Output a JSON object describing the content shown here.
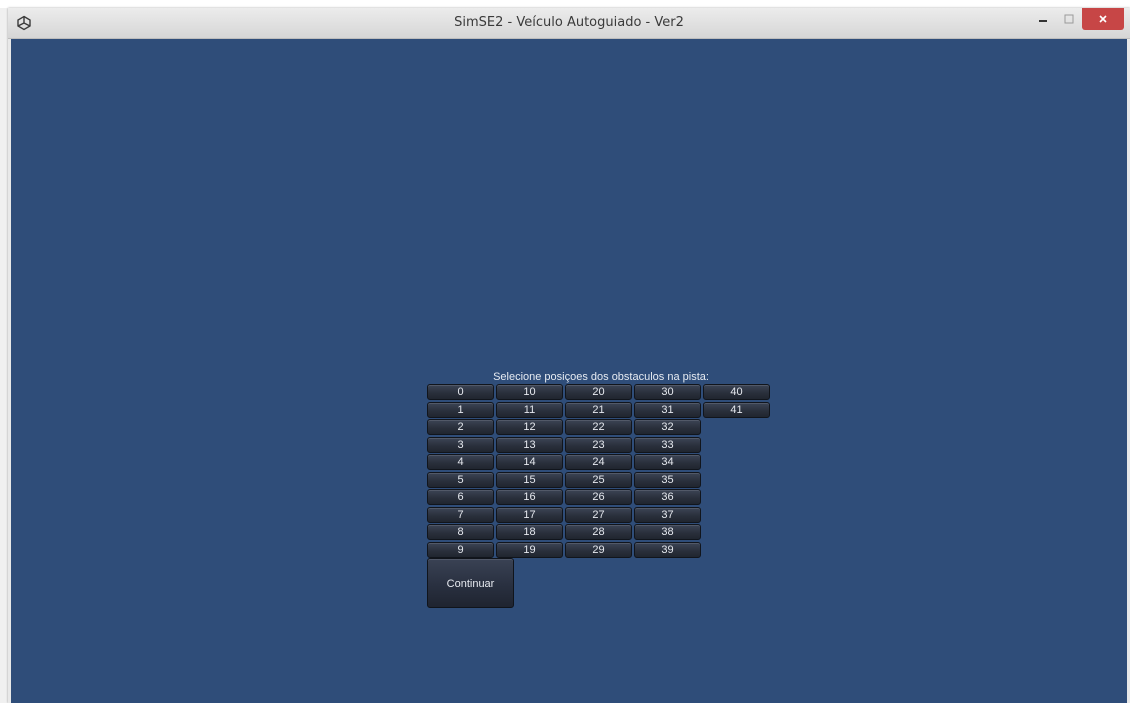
{
  "window": {
    "title": "SimSE2 - Veículo Autoguiado - Ver2",
    "icon": "unity-logo-icon",
    "controls": {
      "minimize_icon": "minimize-icon",
      "maximize_icon": "maximize-icon",
      "close_icon": "close-icon"
    }
  },
  "obstacle_selector": {
    "prompt": "Selecione posiçoes dos obstaculos na pista:",
    "columns": [
      [
        "0",
        "1",
        "2",
        "3",
        "4",
        "5",
        "6",
        "7",
        "8",
        "9"
      ],
      [
        "10",
        "11",
        "12",
        "13",
        "14",
        "15",
        "16",
        "17",
        "18",
        "19"
      ],
      [
        "20",
        "21",
        "22",
        "23",
        "24",
        "25",
        "26",
        "27",
        "28",
        "29"
      ],
      [
        "30",
        "31",
        "32",
        "33",
        "34",
        "35",
        "36",
        "37",
        "38",
        "39"
      ],
      [
        "40",
        "41"
      ]
    ],
    "continue_label": "Continuar"
  },
  "colors": {
    "background": "#2f4d79",
    "button": "#2a303c",
    "close_button": "#c74646"
  }
}
